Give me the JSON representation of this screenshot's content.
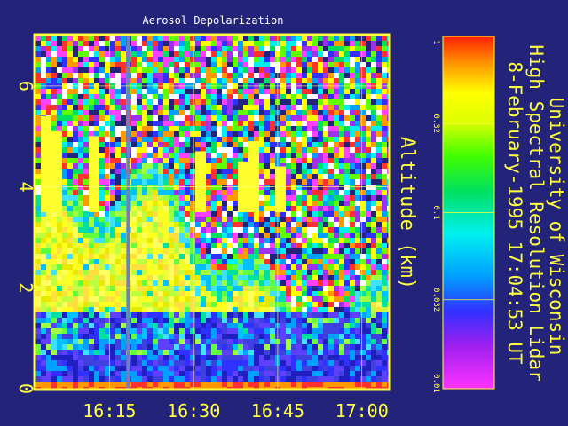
{
  "chart_data": {
    "type": "heatmap",
    "title": "Aerosol Depolarization",
    "x": {
      "label": "",
      "ticks": [
        {
          "value": 16.25,
          "label": "16:15"
        },
        {
          "value": 16.5,
          "label": "16:30"
        },
        {
          "value": 16.75,
          "label": "16:45"
        },
        {
          "value": 17.0,
          "label": "17:00"
        }
      ],
      "range": [
        16.03,
        17.08
      ]
    },
    "y": {
      "label": "Altitude (km)",
      "ticks": [
        {
          "value": 0,
          "label": "0"
        },
        {
          "value": 2,
          "label": "2"
        },
        {
          "value": 4,
          "label": "4"
        },
        {
          "value": 6,
          "label": "6"
        }
      ],
      "range": [
        0,
        7
      ]
    },
    "colorbar": {
      "scale": "log",
      "range": [
        0.01,
        1
      ],
      "ticks": [
        {
          "value": 1,
          "label": "1"
        },
        {
          "value": 0.32,
          "label": "0.32"
        },
        {
          "value": 0.1,
          "label": "0.1"
        },
        {
          "value": 0.032,
          "label": "0.032"
        },
        {
          "value": 0.01,
          "label": "0.01"
        }
      ]
    },
    "grid": true,
    "data_gap": {
      "x_start": 16.3,
      "x_end": 16.31
    },
    "colors": {
      "background": "#23237a",
      "frame": "#ffff40",
      "title": "#ffffff"
    }
  },
  "side_text": {
    "line1": "University of Wisconsin",
    "line2": "High Spectral Resolution Lidar",
    "line3": "8-February-1995 17:04:53 UT"
  }
}
